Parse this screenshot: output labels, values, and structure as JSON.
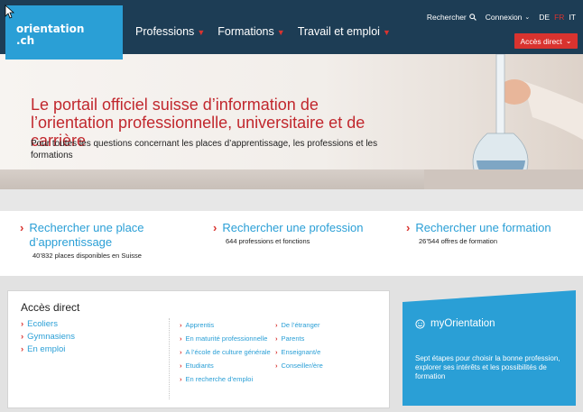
{
  "header": {
    "logo_line1": "orientation",
    "logo_line2": ".ch",
    "nav": [
      {
        "label": "Professions"
      },
      {
        "label": "Formations"
      },
      {
        "label": "Travail et emploi"
      }
    ],
    "search_label": "Rechercher",
    "login_label": "Connexion",
    "languages": [
      "DE",
      "FR",
      "IT"
    ],
    "active_language": "FR",
    "direct_access_label": "Accès direct"
  },
  "hero": {
    "title": "Le portail officiel suisse d’information de l’orientation professionnelle, universitaire et de carrière",
    "subtitle": "Pour toutes les questions concernant les places d’apprentissage, les professions et les formations"
  },
  "search_blocks": [
    {
      "label": "Rechercher une place d’apprentissage",
      "note": "40’832 places disponibles en Suisse"
    },
    {
      "label": "Rechercher une profession",
      "note": "644 professions et fonctions"
    },
    {
      "label": "Rechercher une formation",
      "note": "26’544 offres de formation"
    }
  ],
  "direct_access": {
    "title": "Accès direct",
    "left": [
      "Ecoliers",
      "Gymnasiens",
      "En emploi"
    ],
    "middle": [
      "Apprentis",
      "En maturité professionnelle",
      "A l’école de culture générale",
      "Etudiants",
      "En recherche d’emploi"
    ],
    "right": [
      "De l’étranger",
      "Parents",
      "Enseignant/e",
      "Conseiller/ère"
    ]
  },
  "my_orientation": {
    "title": "myOrientation",
    "text": "Sept étapes pour choisir la bonne profession, explorer ses intérêts et les possibilités de formation"
  },
  "colors": {
    "brand_blue": "#2a9fd6",
    "header_dark": "#1d3d55",
    "accent_red": "#d9332f"
  },
  "icons": [
    "cursor-icon",
    "chevron-down-icon",
    "search-icon",
    "arrow-right-icon",
    "smiley-icon"
  ]
}
